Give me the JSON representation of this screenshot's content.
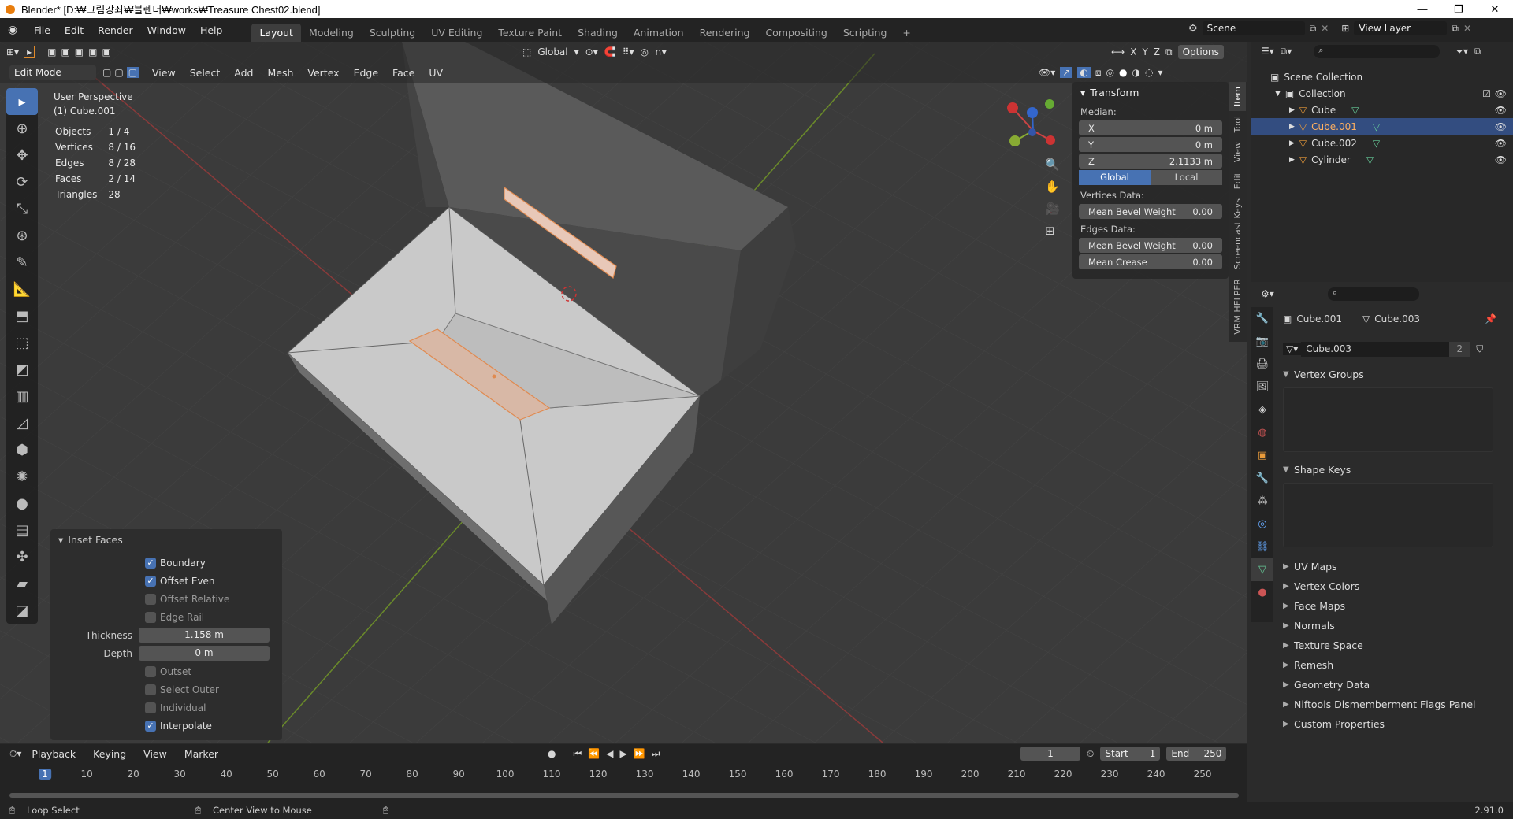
{
  "window": {
    "title": "Blender* [D:₩그림강좌₩블렌더₩works₩Treasure Chest02.blend]",
    "minimize": "—",
    "maximize": "❐",
    "close": "✕"
  },
  "menus": [
    "File",
    "Edit",
    "Render",
    "Window",
    "Help"
  ],
  "workspaces": [
    "Layout",
    "Modeling",
    "Sculpting",
    "UV Editing",
    "Texture Paint",
    "Shading",
    "Animation",
    "Rendering",
    "Compositing",
    "Scripting"
  ],
  "scene": {
    "label": "Scene",
    "view_layer": "View Layer"
  },
  "viewport_header": {
    "mode": "Edit Mode",
    "menus": [
      "View",
      "Select",
      "Add",
      "Mesh",
      "Vertex",
      "Edge",
      "Face",
      "UV"
    ],
    "orientation": "Global",
    "options": "Options",
    "axes": [
      "X",
      "Y",
      "Z"
    ]
  },
  "overlay": {
    "view": "User Perspective",
    "object": "(1) Cube.001",
    "stats": [
      {
        "k": "Objects",
        "v": "1 / 4"
      },
      {
        "k": "Vertices",
        "v": "8 / 16"
      },
      {
        "k": "Edges",
        "v": "8 / 28"
      },
      {
        "k": "Faces",
        "v": "2 / 14"
      },
      {
        "k": "Triangles",
        "v": "28"
      }
    ]
  },
  "npanel": {
    "title": "Transform",
    "median": "Median:",
    "x_label": "X",
    "x": "0 m",
    "y_label": "Y",
    "y": "0 m",
    "z_label": "Z",
    "z": "2.1133 m",
    "global": "Global",
    "local": "Local",
    "vertices_data": "Vertices Data:",
    "mean_bevel_v": "Mean Bevel Weight",
    "mean_bevel_v_val": "0.00",
    "edges_data": "Edges Data:",
    "mean_bevel_e": "Mean Bevel Weight",
    "mean_bevel_e_val": "0.00",
    "mean_crease": "Mean Crease",
    "mean_crease_val": "0.00",
    "tabs": [
      "Item",
      "Tool",
      "View",
      "Edit",
      "Screencast Keys",
      "VRM HELPER"
    ]
  },
  "inset": {
    "title": "Inset Faces",
    "boundary": "Boundary",
    "offset_even": "Offset Even",
    "offset_relative": "Offset Relative",
    "edge_rail": "Edge Rail",
    "thickness_label": "Thickness",
    "thickness": "1.158 m",
    "depth_label": "Depth",
    "depth": "0 m",
    "outset": "Outset",
    "select_outer": "Select Outer",
    "individual": "Individual",
    "interpolate": "Interpolate"
  },
  "outliner": {
    "root": "Scene Collection",
    "collection": "Collection",
    "items": [
      "Cube",
      "Cube.001",
      "Cube.002",
      "Cylinder"
    ]
  },
  "properties": {
    "object": "Cube.001",
    "mesh": "Cube.003",
    "mesh_field": "Cube.003",
    "users": "2",
    "vertex_groups": "Vertex Groups",
    "shape_keys": "Shape Keys",
    "sections": [
      "UV Maps",
      "Vertex Colors",
      "Face Maps",
      "Normals",
      "Texture Space",
      "Remesh",
      "Geometry Data",
      "Niftools Dismemberment Flags Panel",
      "Custom Properties"
    ]
  },
  "timeline": {
    "menus": [
      "Playback",
      "Keying",
      "View",
      "Marker"
    ],
    "current": "1",
    "start_label": "Start",
    "start": "1",
    "end_label": "End",
    "end": "250",
    "ticks": [
      "1",
      "10",
      "20",
      "30",
      "40",
      "50",
      "60",
      "70",
      "80",
      "90",
      "100",
      "110",
      "120",
      "130",
      "140",
      "150",
      "160",
      "170",
      "180",
      "190",
      "200",
      "210",
      "220",
      "230",
      "240",
      "250"
    ]
  },
  "statusbar": {
    "left": "Loop Select",
    "middle": "Center View to Mouse",
    "version": "2.91.0"
  }
}
